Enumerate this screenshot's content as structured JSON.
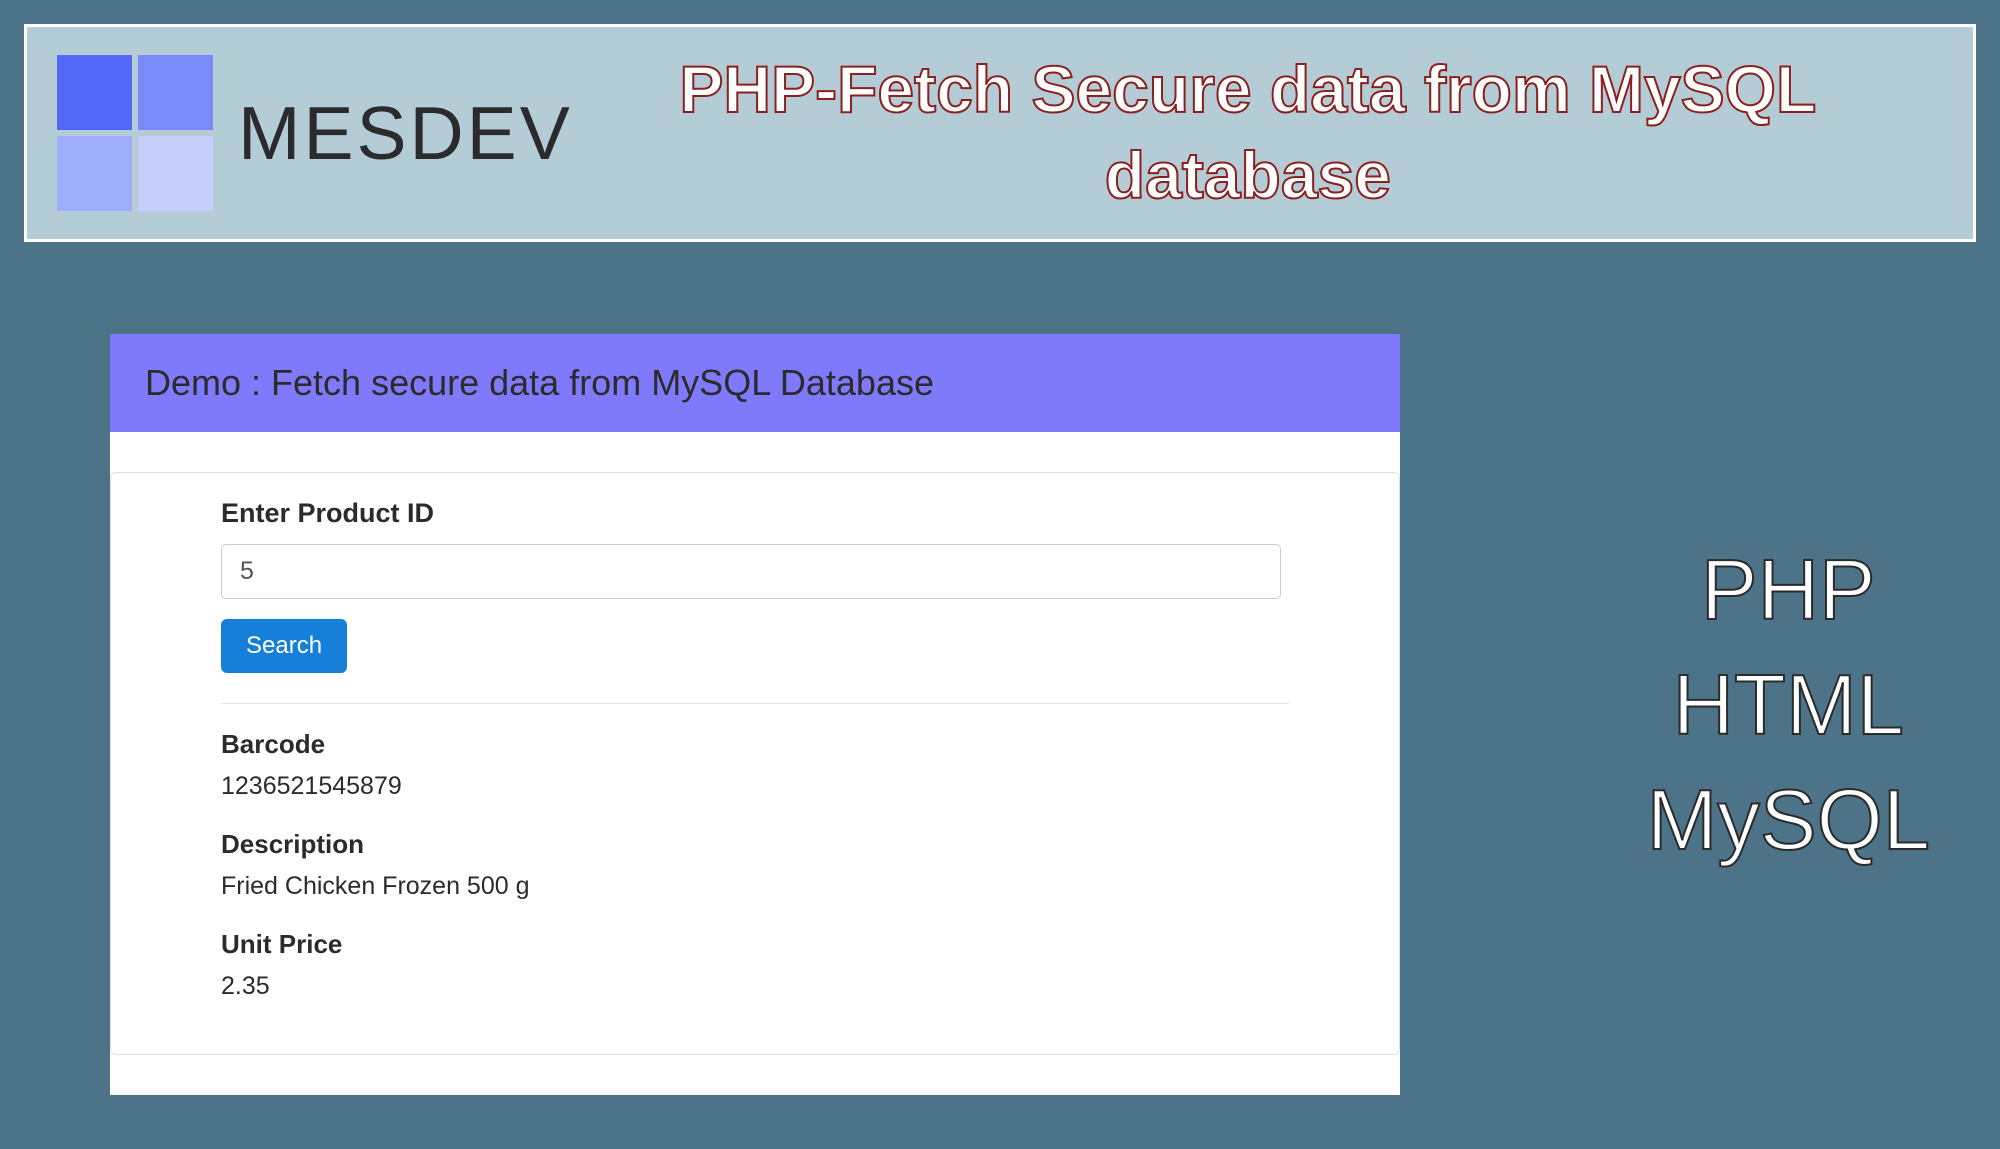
{
  "header": {
    "logo_text": "MESDEV",
    "title": "PHP-Fetch Secure data from MySQL database"
  },
  "demo": {
    "title": "Demo : Fetch secure data from MySQL Database",
    "form_label": "Enter Product ID",
    "input_value": "5",
    "search_button": "Search",
    "fields": {
      "barcode_label": "Barcode",
      "barcode_value": "1236521545879",
      "description_label": "Description",
      "description_value": "Fried Chicken Frozen 500 g",
      "unit_price_label": "Unit Price",
      "unit_price_value": "2.35"
    }
  },
  "side": {
    "line1": "PHP",
    "line2": "HTML",
    "line3": "MySQL"
  }
}
